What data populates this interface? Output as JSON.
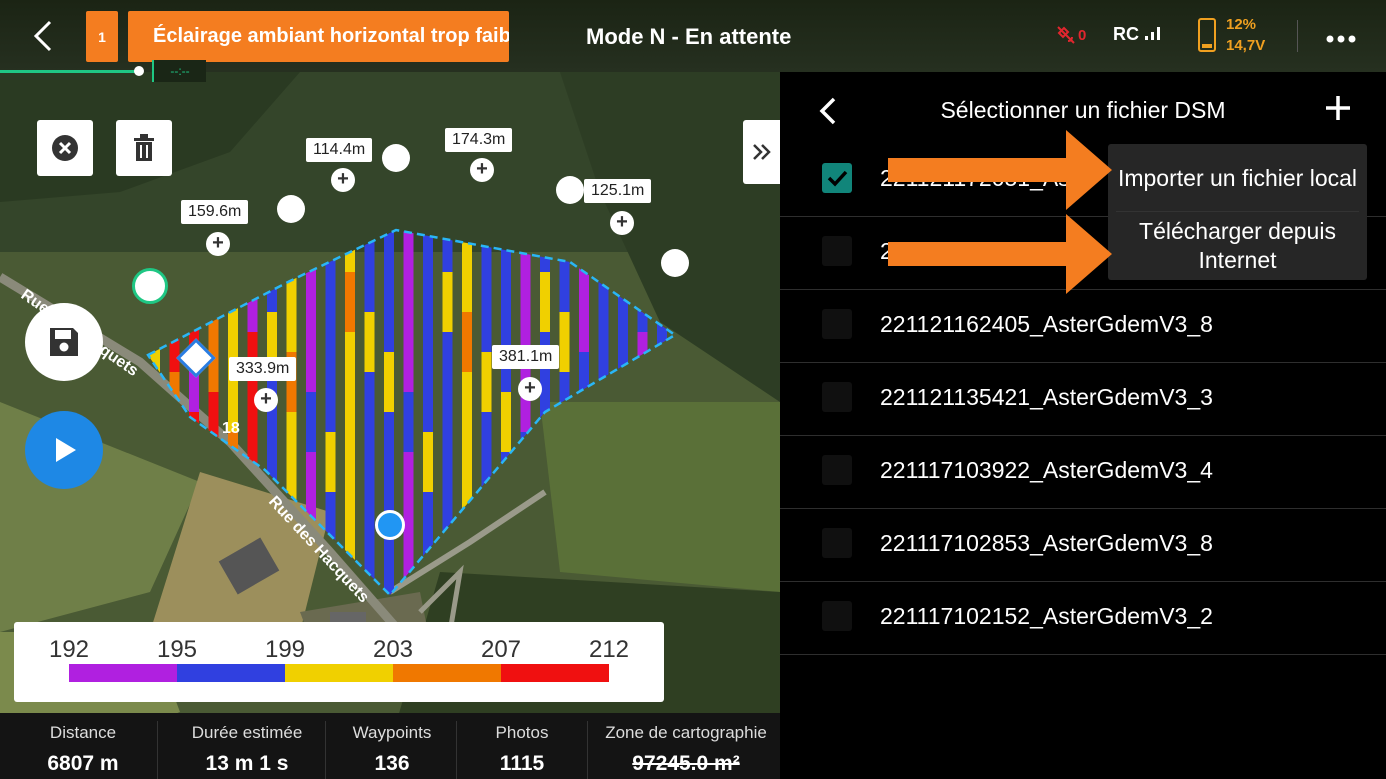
{
  "header": {
    "warning_count": "1",
    "warning_message": "Éclairage ambiant horizontal trop faible",
    "mode": "Mode N - En attente",
    "gps_signal": "0",
    "rc_label": "RC",
    "battery_percent": "12%",
    "battery_voltage": "14,7V",
    "progress_label": "--:--",
    "colors": {
      "warning": "#f47d20",
      "battery": "#f0a020",
      "progress": "#1fc784"
    }
  },
  "map": {
    "road_name": "Rue des Hacquets",
    "waypoint_number": "18",
    "distance_labels": [
      "159.6m",
      "114.4m",
      "174.3m",
      "125.1m",
      "333.9m",
      "381.1m"
    ]
  },
  "legend": {
    "ticks": [
      "192",
      "195",
      "199",
      "203",
      "207",
      "212"
    ],
    "colors": [
      "#b020e0",
      "#3040e0",
      "#f0d000",
      "#f07800",
      "#f01010"
    ]
  },
  "stats": [
    {
      "label": "Distance",
      "value": "6807 m"
    },
    {
      "label": "Durée estimée",
      "value": "13 m 1 s"
    },
    {
      "label": "Waypoints",
      "value": "136"
    },
    {
      "label": "Photos",
      "value": "1115"
    },
    {
      "label": "Zone de cartographie",
      "value": "97245.0 m²"
    }
  ],
  "panel": {
    "title": "Sélectionner un fichier DSM",
    "files": [
      {
        "name": "221121172051_Aster",
        "checked": true
      },
      {
        "name": "2",
        "checked": false
      },
      {
        "name": "221121162405_AsterGdemV3_8",
        "checked": false
      },
      {
        "name": "221121135421_AsterGdemV3_3",
        "checked": false
      },
      {
        "name": "221117103922_AsterGdemV3_4",
        "checked": false
      },
      {
        "name": "221117102853_AsterGdemV3_8",
        "checked": false
      },
      {
        "name": "221117102152_AsterGdemV3_2",
        "checked": false
      }
    ],
    "menu": {
      "import_local": "Importer un fichier local",
      "download_internet": "Télécharger depuis Internet"
    },
    "accent": "#11857a"
  }
}
